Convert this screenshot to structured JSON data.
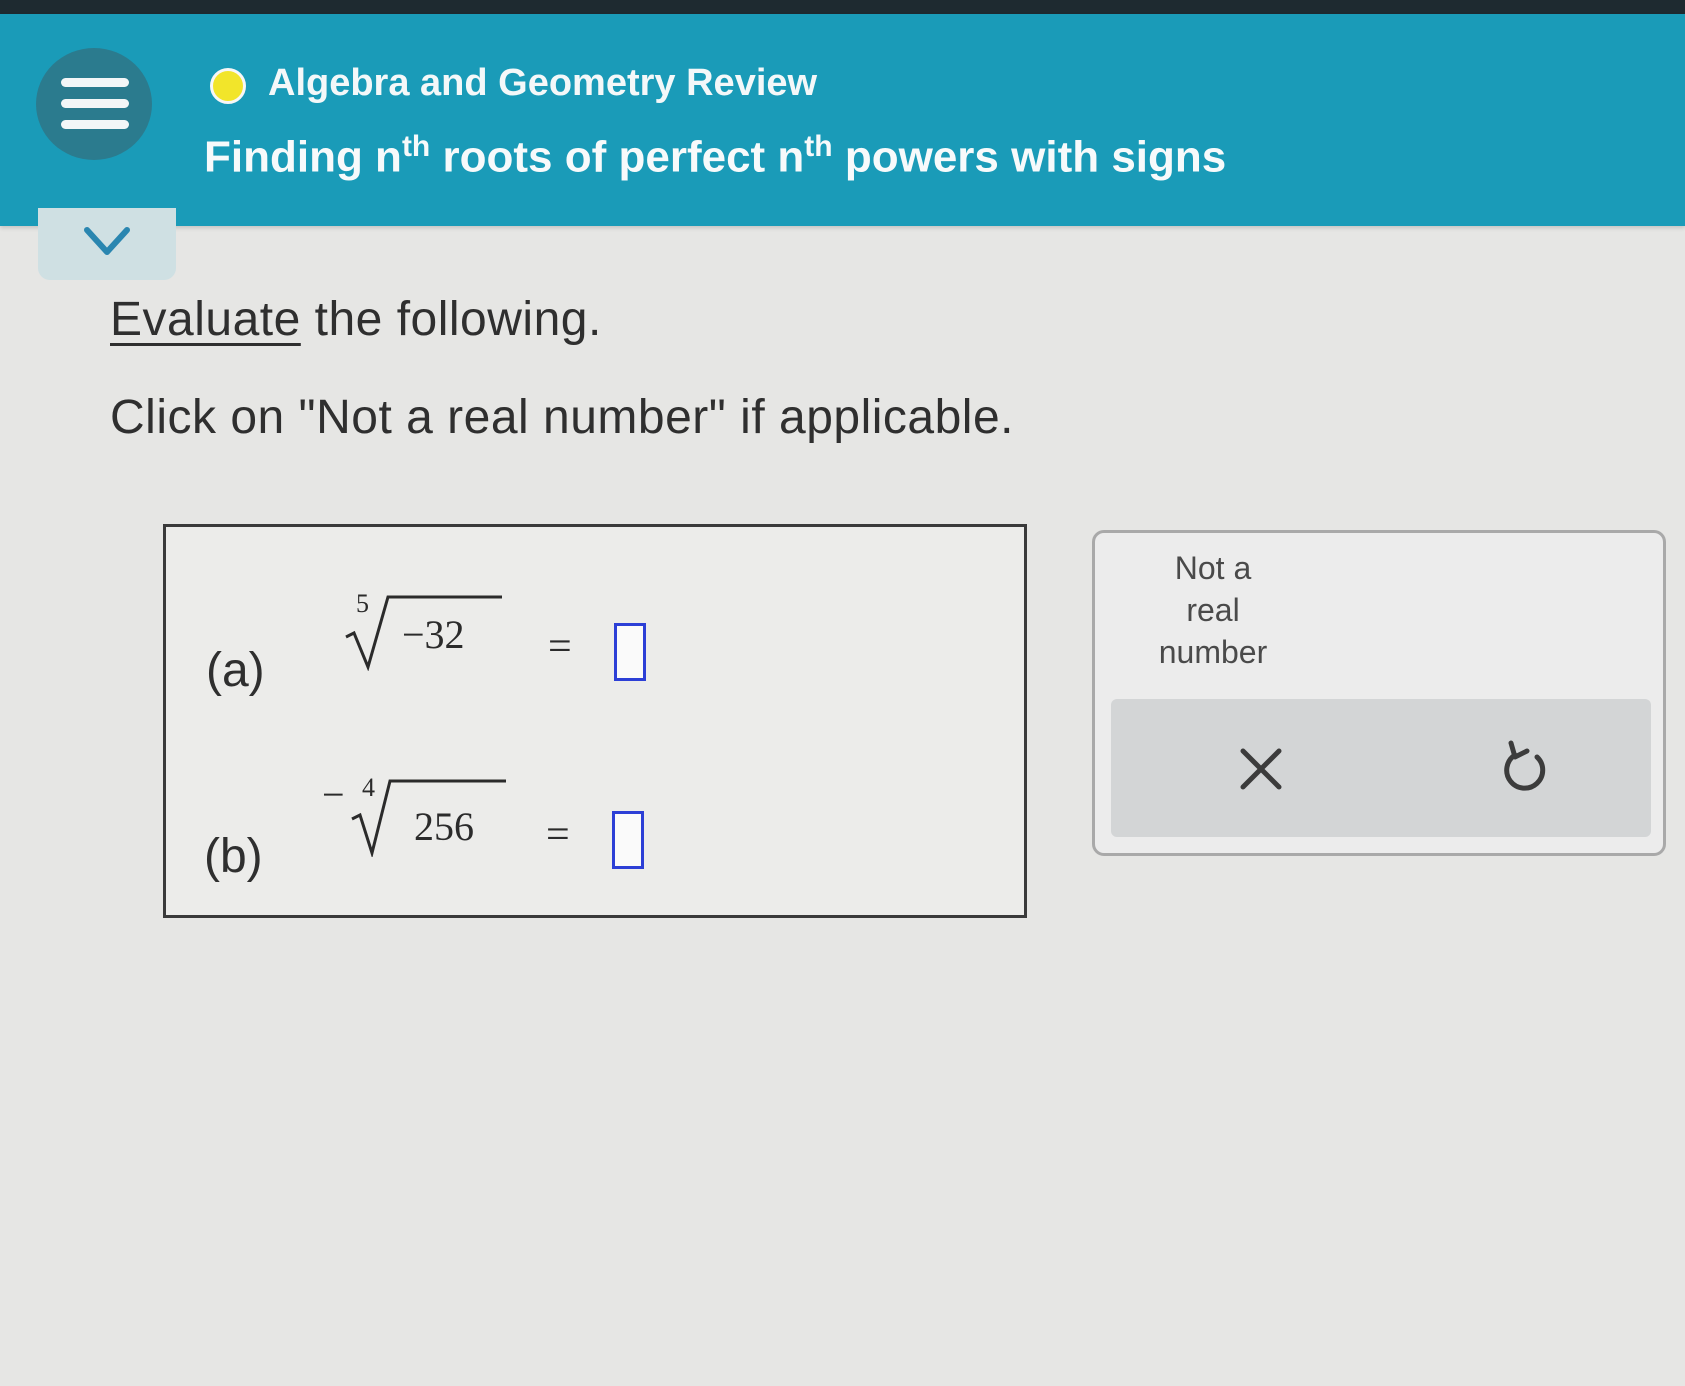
{
  "header": {
    "topic": "Algebra and Geometry Review",
    "title_part1": "Finding n",
    "title_sup1": "th",
    "title_part2": " roots of perfect n",
    "title_sup2": "th",
    "title_part3": " powers with signs",
    "menu_icon": "hamburger-icon",
    "status_color": "#f2e52a",
    "accent_color": "#1a9bb8"
  },
  "instructions": {
    "link_word": "Evaluate",
    "line1_rest": " the following.",
    "line2": "Click on \"Not a real number\" if applicable."
  },
  "problems": [
    {
      "label": "(a)",
      "sign": "",
      "index": "5",
      "radicand": "−32",
      "equals": "=",
      "answer": ""
    },
    {
      "label": "(b)",
      "sign": "−",
      "index": "4",
      "radicand": "256",
      "equals": "=",
      "answer": ""
    }
  ],
  "keypad": {
    "not_real_line1": "Not a",
    "not_real_line2": "real",
    "not_real_line3": "number",
    "clear_icon": "close-icon",
    "undo_icon": "undo-icon"
  }
}
